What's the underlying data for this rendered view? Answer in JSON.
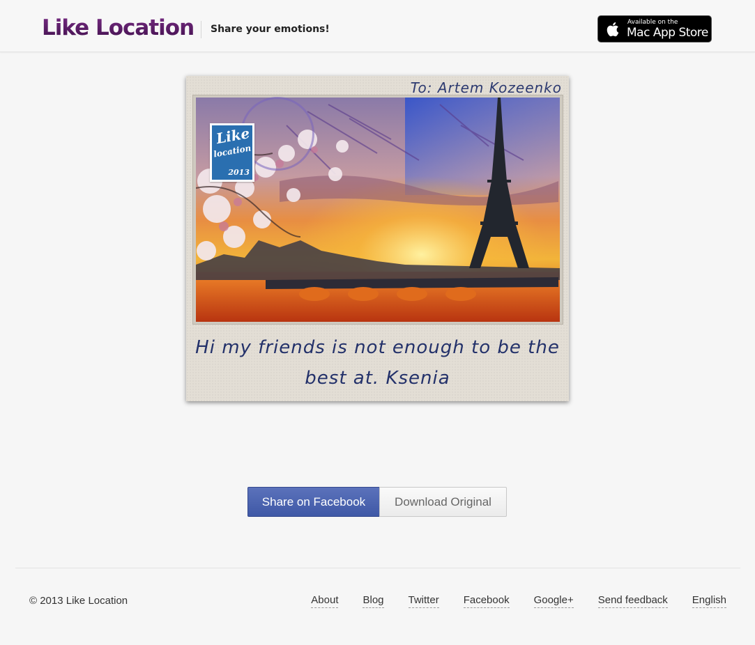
{
  "header": {
    "logo": "Like Location",
    "tagline": "Share your emotions!",
    "appstore": {
      "small_text": "Available on the",
      "big_text": "Mac App Store"
    }
  },
  "postcard": {
    "recipient": "To: Artem Kozeenko",
    "message": "Hi my friends is not enough to be the best at. Ksenia",
    "stamp": {
      "like": "Like",
      "location": "location",
      "year": "2013"
    }
  },
  "actions": {
    "share_facebook": "Share on Facebook",
    "download_original": "Download Original"
  },
  "footer": {
    "copyright": "© 2013 Like Location",
    "links": [
      "About",
      "Blog",
      "Twitter",
      "Facebook",
      "Google+",
      "Send feedback",
      "English"
    ]
  },
  "colors": {
    "logo": "#5a1e66",
    "facebook_button": "#4a62ad",
    "handwriting": "#23316a",
    "stamp": "#2a6fb0"
  }
}
